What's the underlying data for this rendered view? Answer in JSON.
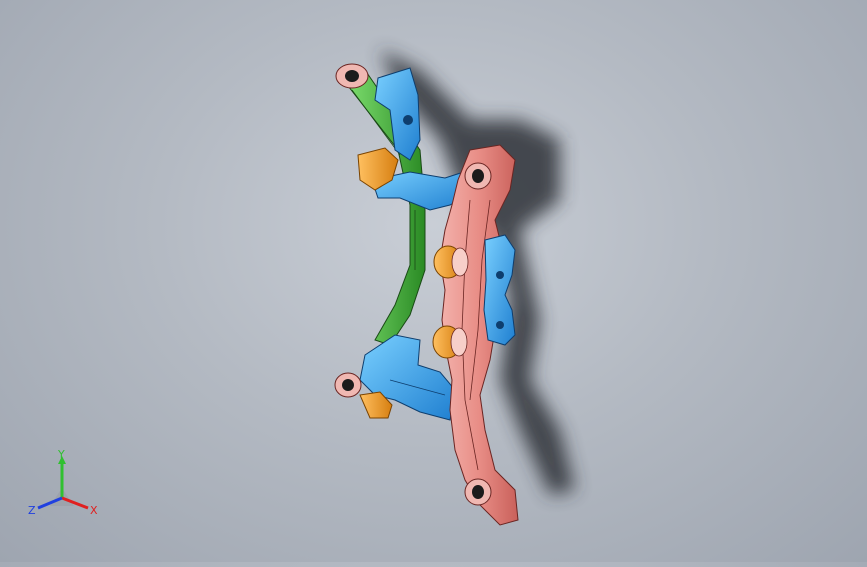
{
  "viewport": {
    "colors": {
      "background_center": "#c9ced6",
      "background_edge": "#9ea5b0",
      "subframe": "#e7918a",
      "lower_arm": "#3aa2e6",
      "upper_arm": "#43b336",
      "bushing": "#f0a12b",
      "mount_bracket": "#3c9ce3",
      "shadow": "#2f3238"
    },
    "model_parts": [
      "subframe",
      "lower-control-arm",
      "upper-link",
      "bushing",
      "mount-bracket"
    ]
  },
  "triad": {
    "x_label": "X",
    "y_label": "Y",
    "z_label": "Z",
    "x_color": "#e02020",
    "y_color": "#30c030",
    "z_color": "#2040e0"
  }
}
